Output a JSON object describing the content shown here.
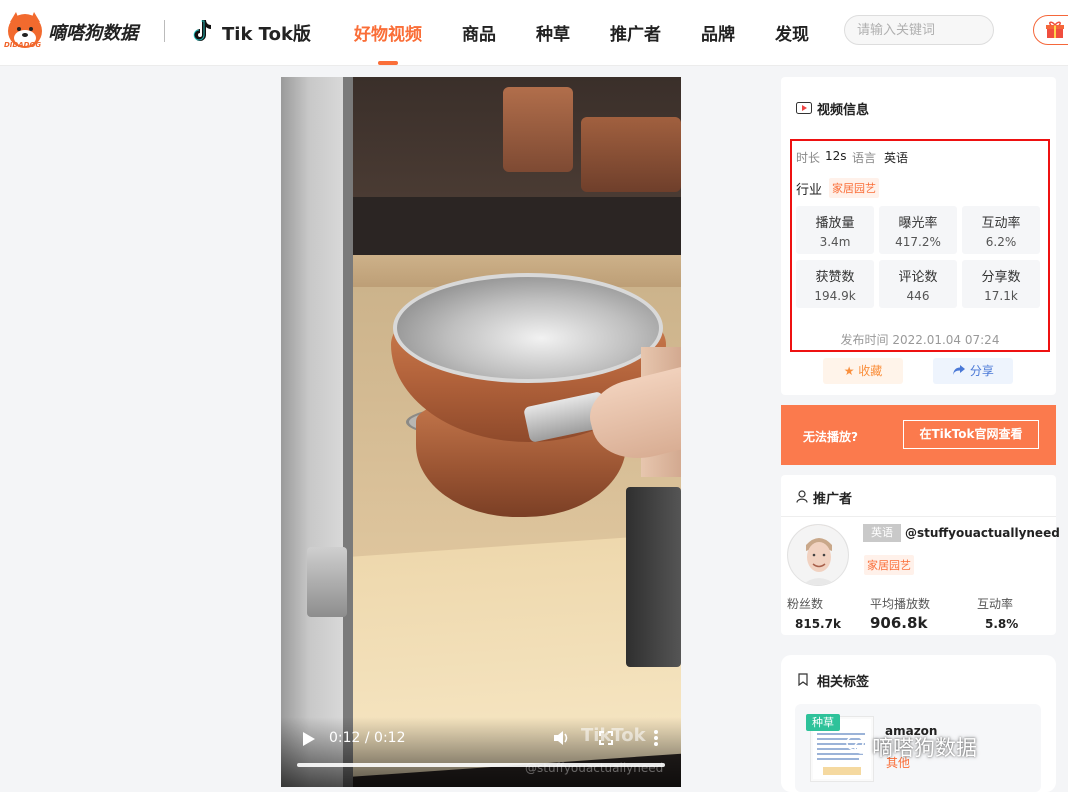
{
  "header": {
    "brand": "嘀嗒狗数据",
    "brand_sub": "DIDADOG",
    "platform": "Tik Tok版",
    "nav": [
      "好物视频",
      "商品",
      "种草",
      "推广者",
      "品牌",
      "发现"
    ],
    "active_nav": "好物视频",
    "search_placeholder": "请输入关键词",
    "accent_color": "#fa6e38"
  },
  "video": {
    "time": "0:12 / 0:12",
    "watermark": "TikTok",
    "handle_watermark": "@stuffyouactuallyneed",
    "progress": 1.0
  },
  "info": {
    "title": "视频信息",
    "duration_label": "时长",
    "duration": "12s",
    "language_label": "语言",
    "language": "英语",
    "industry_label": "行业",
    "industry": "家居园艺",
    "stats": [
      {
        "label": "播放量",
        "value": "3.4m"
      },
      {
        "label": "曝光率",
        "value": "417.2%"
      },
      {
        "label": "互动率",
        "value": "6.2%"
      },
      {
        "label": "获赞数",
        "value": "194.9k"
      },
      {
        "label": "评论数",
        "value": "446"
      },
      {
        "label": "分享数",
        "value": "17.1k"
      }
    ],
    "publish_time": "发布时间 2022.01.04 07:24",
    "favorite": "收藏",
    "share": "分享"
  },
  "banner": {
    "text": "无法播放?",
    "button": "在TikTok官网查看"
  },
  "promoter": {
    "title": "推广者",
    "language": "英语",
    "handle": "@stuffyouactuallyneed",
    "category": "家居园艺",
    "followers_label": "粉丝数",
    "followers": "815.7k",
    "avg_plays_label": "平均播放数",
    "avg_plays": "906.8k",
    "engagement_label": "互动率",
    "engagement": "5.8%"
  },
  "related": {
    "title": "相关标签",
    "badge": "种草",
    "name": "amazon",
    "category": "其他"
  },
  "watermark": "嘀嗒狗数据"
}
